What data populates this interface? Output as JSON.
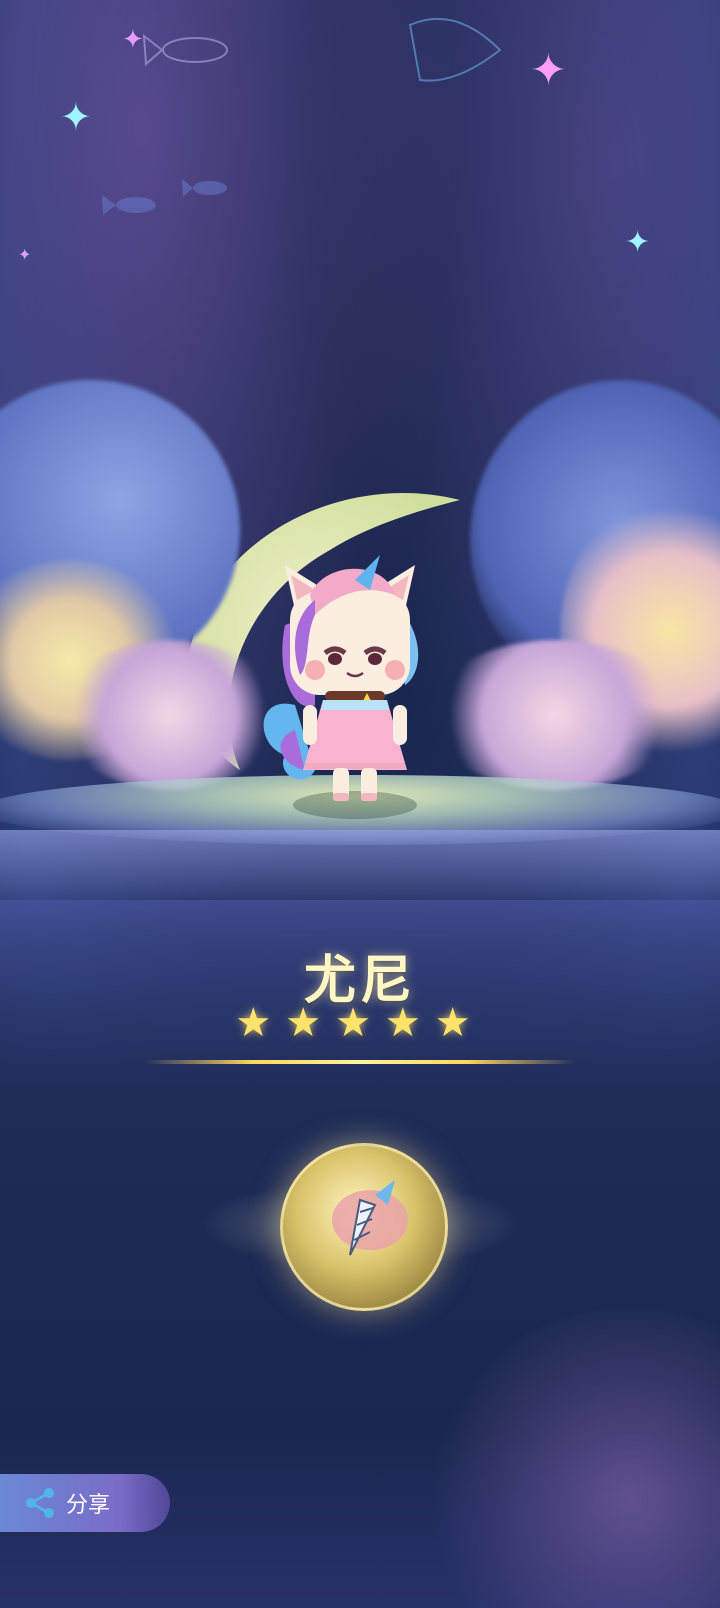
{
  "character": {
    "name": "尤尼",
    "rating": 5,
    "star_glyph": "★"
  },
  "share": {
    "label": "分享"
  },
  "colors": {
    "name_text": "#fff7c4",
    "star": "#ffe36b",
    "share_button": "#7a6cc9"
  }
}
